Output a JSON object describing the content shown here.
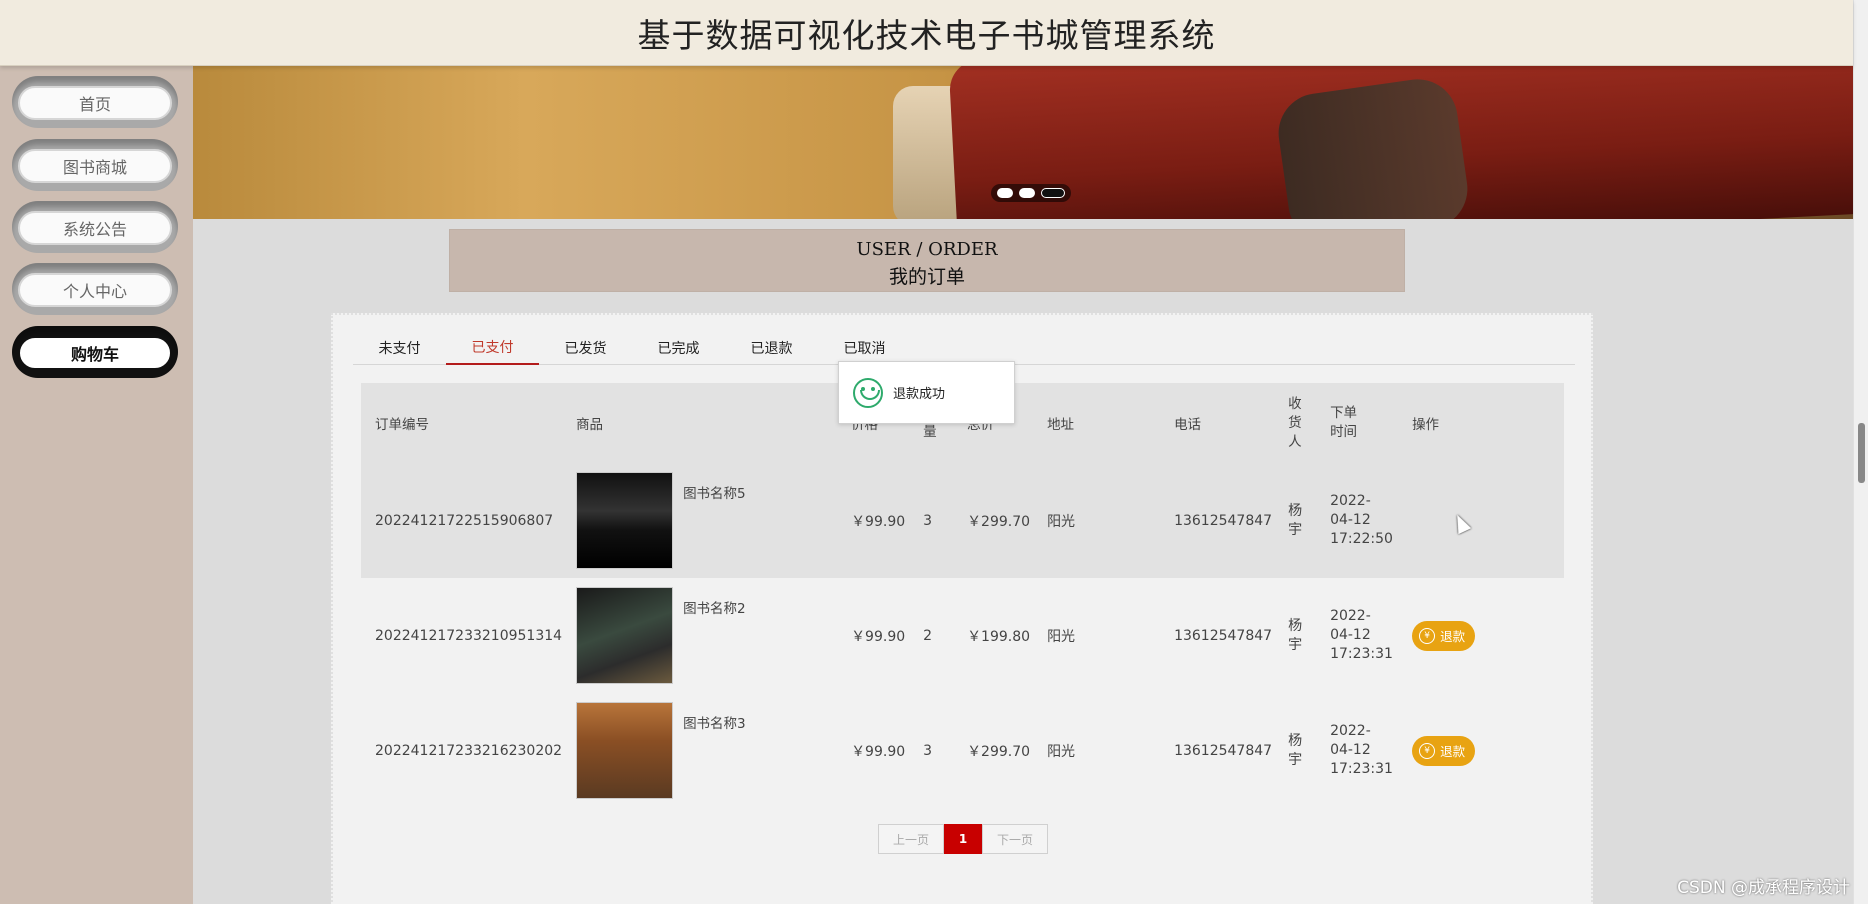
{
  "header": {
    "title": "基于数据可视化技术电子书城管理系统"
  },
  "sidebar": {
    "items": [
      {
        "label": "首页"
      },
      {
        "label": "图书商城"
      },
      {
        "label": "系统公告"
      },
      {
        "label": "个人中心"
      },
      {
        "label": "购物车",
        "active": true
      }
    ]
  },
  "banner": {
    "slides": 3,
    "active_slide": 3
  },
  "page_heading": {
    "en": "USER / ORDER",
    "cn": "我的订单"
  },
  "tabs": [
    {
      "label": "未支付"
    },
    {
      "label": "已支付",
      "active": true
    },
    {
      "label": "已发货"
    },
    {
      "label": "已完成"
    },
    {
      "label": "已退款"
    },
    {
      "label": "已取消"
    }
  ],
  "toast": {
    "message": "退款成功",
    "icon": "smile-icon"
  },
  "table": {
    "columns": [
      "订单编号",
      "商品",
      "价格",
      "数量",
      "总价",
      "地址",
      "电话",
      "收货人",
      "下单时间",
      "操作"
    ],
    "rows": [
      {
        "order_no": "20224121722515906807",
        "goods_name": "图书名称5",
        "price": "￥99.90",
        "qty": "3",
        "total": "￥299.70",
        "address": "阳光",
        "phone": "13612547847",
        "receiver": "杨宇",
        "time": "2022-04-12 17:22:50",
        "action": ""
      },
      {
        "order_no": "202241217233210951314",
        "goods_name": "图书名称2",
        "price": "￥99.90",
        "qty": "2",
        "total": "￥199.80",
        "address": "阳光",
        "phone": "13612547847",
        "receiver": "杨宇",
        "time": "2022-04-12 17:23:31",
        "action": "退款"
      },
      {
        "order_no": "20224121723321623020​2",
        "goods_name": "图书名称3",
        "price": "￥99.90",
        "qty": "3",
        "total": "￥299.70",
        "address": "阳光",
        "phone": "13612547847",
        "receiver": "杨宇",
        "time": "2022-04-12 17:23:31",
        "action": "退款"
      }
    ]
  },
  "pagination": {
    "prev": "上一页",
    "current": "1",
    "next": "下一页"
  },
  "watermark": "CSDN @成承程序设计",
  "colors": {
    "accent_red": "#c80000",
    "refund_button": "#e8a312",
    "sidebar": "#cdbdb2",
    "header": "#f1ebdf"
  }
}
